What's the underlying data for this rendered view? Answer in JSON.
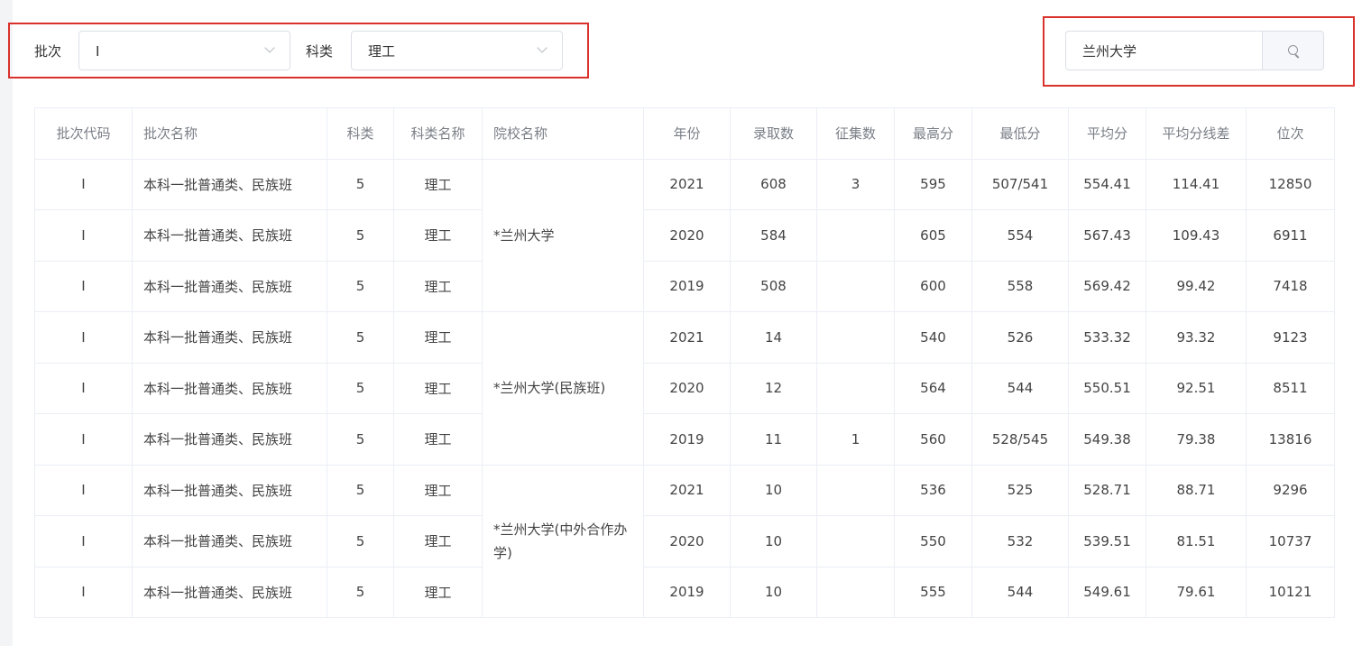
{
  "filters": {
    "batch_label": "批次",
    "batch_value": "I",
    "category_label": "科类",
    "category_value": "理工"
  },
  "search": {
    "value": "兰州大学"
  },
  "table": {
    "columns": [
      "批次代码",
      "批次名称",
      "科类",
      "科类名称",
      "院校名称",
      "年份",
      "录取数",
      "征集数",
      "最高分",
      "最低分",
      "平均分",
      "平均分线差",
      "位次"
    ],
    "groups": [
      {
        "school": "*兰州大学",
        "rows": [
          [
            "I",
            "本科一批普通类、民族班",
            "5",
            "理工",
            "2021",
            "608",
            "3",
            "595",
            "507/541",
            "554.41",
            "114.41",
            "12850"
          ],
          [
            "I",
            "本科一批普通类、民族班",
            "5",
            "理工",
            "2020",
            "584",
            "",
            "605",
            "554",
            "567.43",
            "109.43",
            "6911"
          ],
          [
            "I",
            "本科一批普通类、民族班",
            "5",
            "理工",
            "2019",
            "508",
            "",
            "600",
            "558",
            "569.42",
            "99.42",
            "7418"
          ]
        ]
      },
      {
        "school": "*兰州大学(民族班)",
        "rows": [
          [
            "I",
            "本科一批普通类、民族班",
            "5",
            "理工",
            "2021",
            "14",
            "",
            "540",
            "526",
            "533.32",
            "93.32",
            "9123"
          ],
          [
            "I",
            "本科一批普通类、民族班",
            "5",
            "理工",
            "2020",
            "12",
            "",
            "564",
            "544",
            "550.51",
            "92.51",
            "8511"
          ],
          [
            "I",
            "本科一批普通类、民族班",
            "5",
            "理工",
            "2019",
            "11",
            "1",
            "560",
            "528/545",
            "549.38",
            "79.38",
            "13816"
          ]
        ]
      },
      {
        "school": "*兰州大学(中外合作办学)",
        "rows": [
          [
            "I",
            "本科一批普通类、民族班",
            "5",
            "理工",
            "2021",
            "10",
            "",
            "536",
            "525",
            "528.71",
            "88.71",
            "9296"
          ],
          [
            "I",
            "本科一批普通类、民族班",
            "5",
            "理工",
            "2020",
            "10",
            "",
            "550",
            "532",
            "539.51",
            "81.51",
            "10737"
          ],
          [
            "I",
            "本科一批普通类、民族班",
            "5",
            "理工",
            "2019",
            "10",
            "",
            "555",
            "544",
            "549.61",
            "79.61",
            "10121"
          ]
        ]
      }
    ]
  }
}
